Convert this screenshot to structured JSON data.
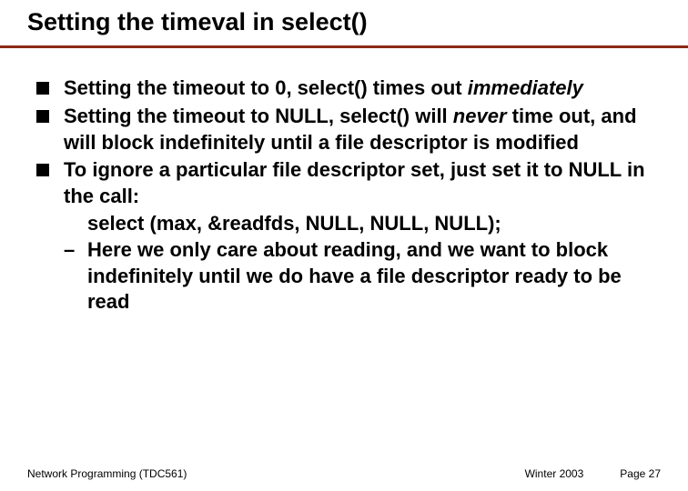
{
  "title": "Setting the timeval in select()",
  "bullets": {
    "b1": {
      "pre": "Setting the timeout to 0, select() times out ",
      "em": "immediately"
    },
    "b2": {
      "pre": "Setting the timeout to NULL, select() will ",
      "em": "never",
      "post": " time out, and will block indefinitely until a file descriptor is modified"
    },
    "b3": {
      "pre": "To ignore a particular file descriptor set, just set it to NULL in the call:"
    },
    "code": "select (max, &readfds, NULL, NULL, NULL);",
    "sub": "Here we only care about reading, and we want to block indefinitely until we do have a file descriptor ready to be read"
  },
  "footer": {
    "left": "Network Programming (TDC561)",
    "term": "Winter 2003",
    "page_label": "Page",
    "page_num": "27"
  }
}
